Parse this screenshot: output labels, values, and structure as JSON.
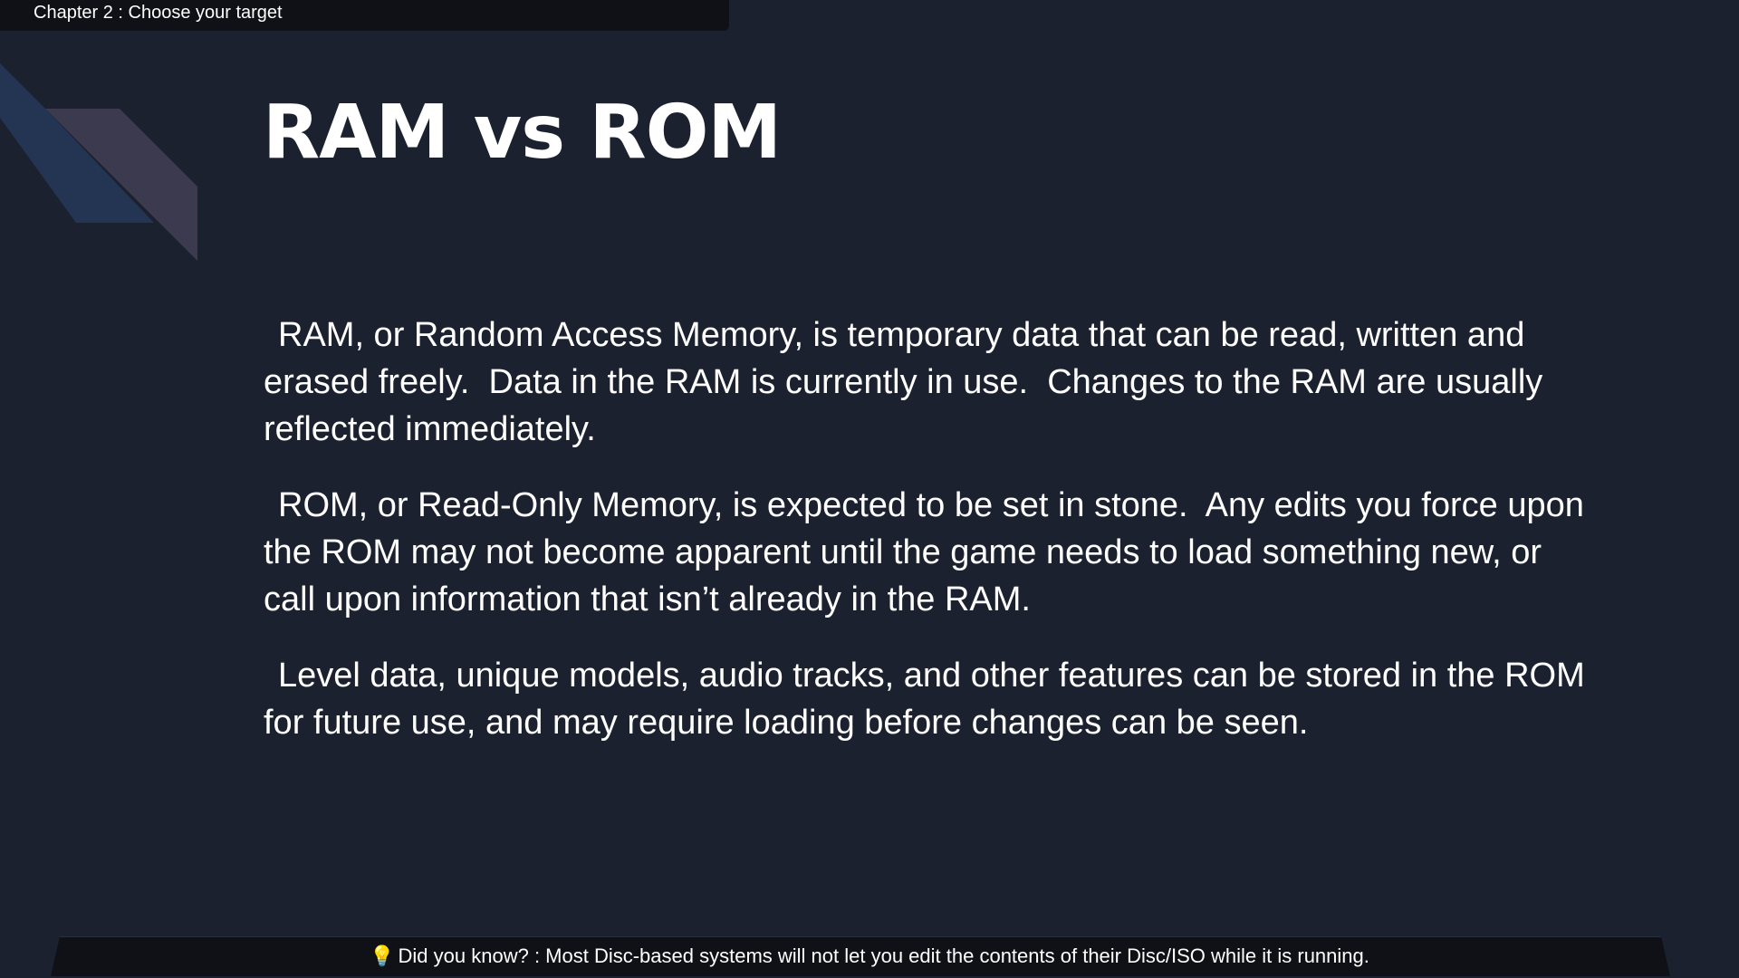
{
  "header": {
    "chapter_label": "Chapter 2 : Choose your target"
  },
  "slide": {
    "title": "RAM vs ROM",
    "paragraphs": [
      "RAM, or Random Access Memory, is temporary data that can be read, written and erased freely.  Data in the RAM is currently in use.  Changes to the RAM are usually reflected immediately.",
      "ROM, or Read-Only Memory, is expected to be set in stone.  Any edits you force upon the ROM may not become apparent until the game needs to load something new, or call upon information that isn’t already in the RAM.",
      "Level data, unique models, audio tracks, and other features can be stored in the ROM for future use, and may require loading before changes can be seen."
    ]
  },
  "footer": {
    "icon": "lightbulb-icon",
    "tip_text": "Did you know? : Most Disc-based systems will not let you edit the contents of their Disc/ISO while it is running."
  },
  "colors": {
    "background": "#1c2130",
    "bar": "#0f1117",
    "decor_blue": "#243553",
    "decor_purple": "#3b3a4f",
    "text": "#ffffff"
  }
}
